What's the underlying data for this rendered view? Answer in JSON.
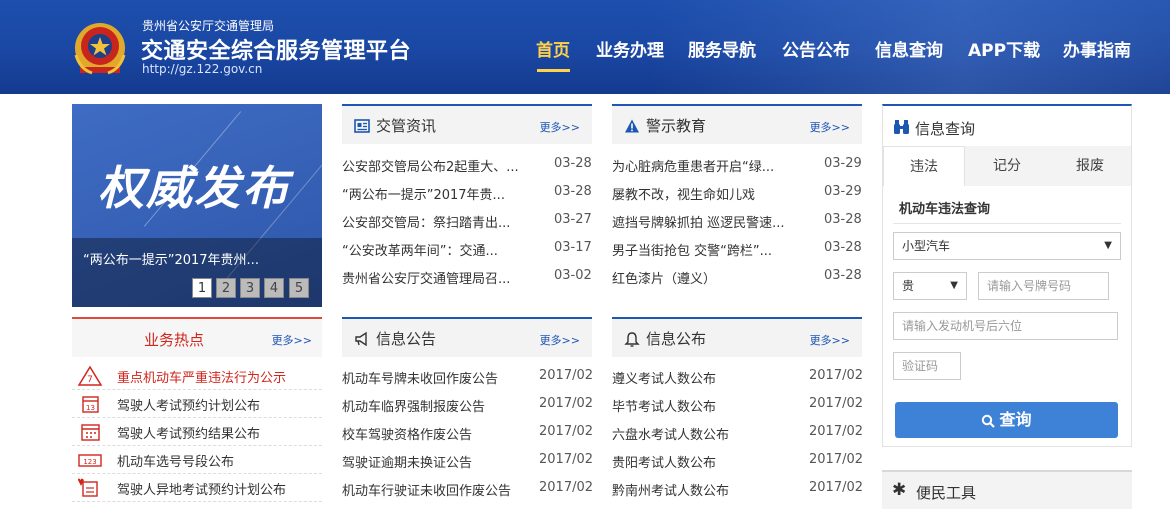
{
  "header": {
    "subtitle": "贵州省公安厅交通管理局",
    "title": "交通安全综合服务管理平台",
    "url": "http://gz.122.gov.cn"
  },
  "nav": {
    "items": [
      "首页",
      "业务办理",
      "服务导航",
      "公告公布",
      "信息查询",
      "APP下载",
      "办事指南"
    ],
    "active": "首页"
  },
  "banner": {
    "image_text": "权威发布",
    "caption": "“两公布一提示”2017年贵州...",
    "pages": [
      "1",
      "2",
      "3",
      "4",
      "5"
    ],
    "active_page": "1"
  },
  "news": {
    "title": "交管资讯",
    "more": "更多>>",
    "items": [
      {
        "title": "公安部交管局公布2起重大、...",
        "date": "03-28"
      },
      {
        "title": "“两公布一提示”2017年贵...",
        "date": "03-28"
      },
      {
        "title": "公安部交管局：祭扫踏青出...",
        "date": "03-27"
      },
      {
        "title": "“公安改革两年间”：交通...",
        "date": "03-17"
      },
      {
        "title": "贵州省公安厅交通管理局召...",
        "date": "03-02"
      }
    ]
  },
  "warning": {
    "title": "警示教育",
    "more": "更多>>",
    "items": [
      {
        "title": "为心脏病危重患者开启“绿...",
        "date": "03-29"
      },
      {
        "title": "屡教不改，视生命如儿戏",
        "date": "03-29"
      },
      {
        "title": "遮挡号牌躲抓拍 巡逻民警速...",
        "date": "03-28"
      },
      {
        "title": "男子当街抢包 交警“跨栏”...",
        "date": "03-28"
      },
      {
        "title": "红色漆片（遵义）",
        "date": "03-28"
      }
    ]
  },
  "hot": {
    "title": "业务热点",
    "more": "更多>>",
    "items": [
      {
        "label": "重点机动车严重违法行为公示",
        "icon": "alert-car-icon",
        "highlight": true
      },
      {
        "label": "驾驶人考试预约计划公布",
        "icon": "calendar-13-icon",
        "highlight": false
      },
      {
        "label": "驾驶人考试预约结果公布",
        "icon": "calendar-check-icon",
        "highlight": false
      },
      {
        "label": "机动车选号号段公布",
        "icon": "plate-number-icon",
        "highlight": false
      },
      {
        "label": "驾驶人异地考试预约计划公布",
        "icon": "location-calendar-icon",
        "highlight": false
      }
    ]
  },
  "notice": {
    "title": "信息公告",
    "more": "更多>>",
    "items": [
      {
        "title": "机动车号牌未收回作废公告",
        "date": "2017/02"
      },
      {
        "title": "机动车临界强制报废公告",
        "date": "2017/02"
      },
      {
        "title": "校车驾驶资格作废公告",
        "date": "2017/02"
      },
      {
        "title": "驾驶证逾期未换证公告",
        "date": "2017/02"
      },
      {
        "title": "机动车行驶证未收回作废公告",
        "date": "2017/02"
      }
    ]
  },
  "publish": {
    "title": "信息公布",
    "more": "更多>>",
    "items": [
      {
        "title": "遵义考试人数公布",
        "date": "2017/02"
      },
      {
        "title": "毕节考试人数公布",
        "date": "2017/02"
      },
      {
        "title": "六盘水考试人数公布",
        "date": "2017/02"
      },
      {
        "title": "贵阳考试人数公布",
        "date": "2017/02"
      },
      {
        "title": "黔南州考试人数公布",
        "date": "2017/02"
      }
    ]
  },
  "query": {
    "title": "信息查询",
    "tabs": [
      "违法",
      "记分",
      "报废"
    ],
    "active_tab": "违法",
    "subtitle": "机动车违法查询",
    "vehicle_type": "小型汽车",
    "province": "贵",
    "plate_placeholder": "请输入号牌号码",
    "engine_placeholder": "请输入发动机号后六位",
    "captcha_placeholder": "验证码",
    "button": "查询"
  },
  "tools": {
    "title": "便民工具"
  },
  "colors": {
    "header_blue": "#1a47a3",
    "accent_blue": "#1e56b3",
    "nav_active": "#ffd24a",
    "hot_red": "#d0261c",
    "button_blue": "#3d82d6"
  }
}
